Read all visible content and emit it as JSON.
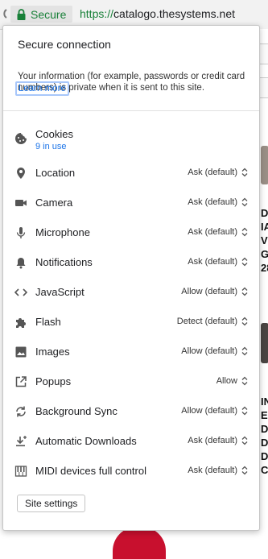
{
  "address_bar": {
    "secure_label": "Secure",
    "url_scheme": "https://",
    "url_host": "catalogo.thesystems.net",
    "secure_color": "#188038"
  },
  "popup": {
    "title": "Secure connection",
    "description": "Your information (for example, passwords or credit card numbers) is private when it is sent to this site.",
    "learn_more": "Learn more",
    "site_settings": "Site settings"
  },
  "permissions": [
    {
      "label": "Cookies",
      "sub": "9 in use",
      "value": "",
      "icon": "cookie-icon"
    },
    {
      "label": "Location",
      "value": "Ask (default)",
      "icon": "location-pin-icon"
    },
    {
      "label": "Camera",
      "value": "Ask (default)",
      "icon": "camera-icon"
    },
    {
      "label": "Microphone",
      "value": "Ask (default)",
      "icon": "microphone-icon"
    },
    {
      "label": "Notifications",
      "value": "Ask (default)",
      "icon": "bell-icon"
    },
    {
      "label": "JavaScript",
      "value": "Allow (default)",
      "icon": "code-icon"
    },
    {
      "label": "Flash",
      "value": "Detect (default)",
      "icon": "puzzle-piece-icon"
    },
    {
      "label": "Images",
      "value": "Allow (default)",
      "icon": "image-icon"
    },
    {
      "label": "Popups",
      "value": "Allow",
      "icon": "popup-external-icon"
    },
    {
      "label": "Background Sync",
      "value": "Allow (default)",
      "icon": "sync-icon"
    },
    {
      "label": "Automatic Downloads",
      "value": "Ask (default)",
      "icon": "download-icon"
    },
    {
      "label": "MIDI devices full control",
      "value": "Ask (default)",
      "icon": "piano-keys-icon"
    }
  ],
  "background_page": {
    "text_block_1": "D\nA\nV\nG\n28",
    "text_block_2": "IN\nE\nD\nD\nD\nC"
  }
}
